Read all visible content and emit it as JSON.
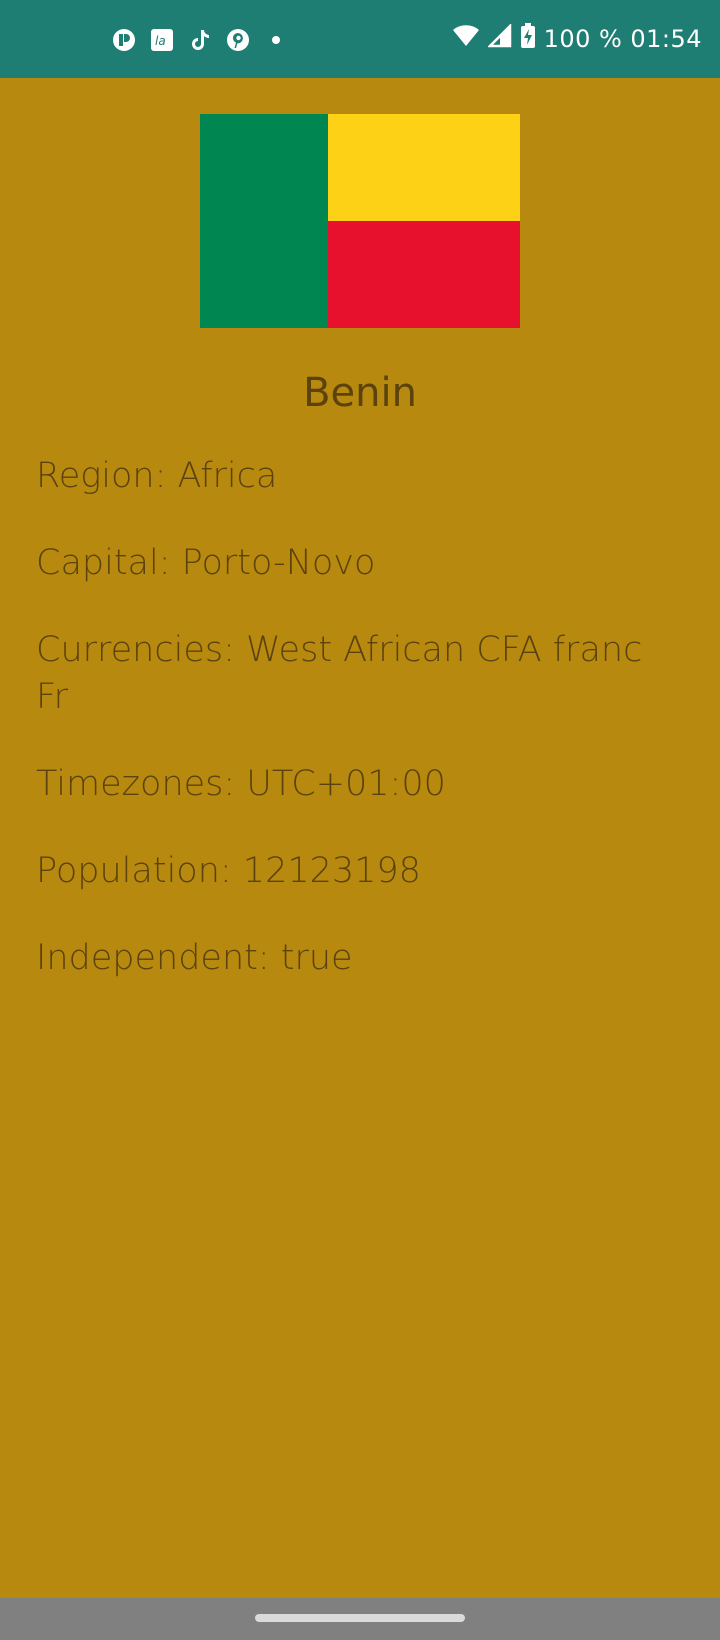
{
  "status_bar": {
    "time": "01:54",
    "battery_text": "100 %",
    "notification_icons": [
      "app-notification-icon",
      "la-icon",
      "tiktok-icon",
      "pinterest-icon",
      "dot-icon"
    ],
    "system_icons": [
      "wifi-icon",
      "signal-icon",
      "battery-charging-icon"
    ]
  },
  "country": {
    "name": "Benin",
    "flag_colors": {
      "green": "#008751",
      "yellow": "#FCD116",
      "red": "#E8112D"
    },
    "info": [
      {
        "label": "Region: Africa"
      },
      {
        "label": "Capital: Porto-Novo"
      },
      {
        "label": "Currencies: West African CFA franc Fr"
      },
      {
        "label": "Timezones: UTC+01:00"
      },
      {
        "label": "Population: 12123198"
      },
      {
        "label": "Independent: true"
      }
    ]
  },
  "colors": {
    "status_bar": "#1F7E74",
    "background": "#B8890F",
    "text": "#5C430D",
    "nav_bar": "#808080"
  }
}
